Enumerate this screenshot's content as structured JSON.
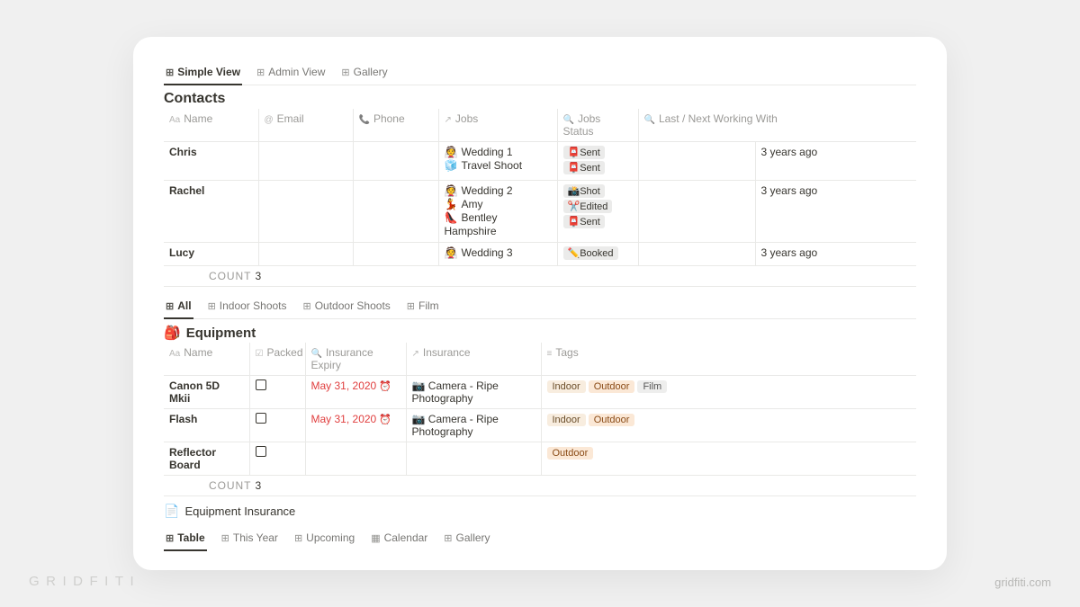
{
  "watermark": {
    "brand": "GRIDFITI",
    "url": "gridfiti.com"
  },
  "contacts": {
    "tabs": [
      {
        "label": "Simple View",
        "icon": "⊞",
        "active": true
      },
      {
        "label": "Admin View",
        "icon": "⊞",
        "active": false
      },
      {
        "label": "Gallery",
        "icon": "⊞",
        "active": false
      }
    ],
    "title": "Contacts",
    "columns": {
      "name": {
        "label": "Name",
        "icon": "Aa"
      },
      "email": {
        "label": "Email",
        "icon": "@"
      },
      "phone": {
        "label": "Phone",
        "icon": "📞"
      },
      "jobs": {
        "label": "Jobs",
        "icon": "↗"
      },
      "status": {
        "label": "Jobs Status",
        "icon": "🔍"
      },
      "last": {
        "label": "Last / Next Working With",
        "icon": "🔍"
      }
    },
    "rows": [
      {
        "name": "Chris",
        "jobs": [
          {
            "emoji": "👰",
            "text": "Wedding 1"
          },
          {
            "emoji": "🧊",
            "text": "Travel Shoot"
          }
        ],
        "status": [
          {
            "emoji": "📮",
            "text": "Sent"
          },
          {
            "emoji": "📮",
            "text": "Sent"
          }
        ],
        "last": "3 years ago"
      },
      {
        "name": "Rachel",
        "jobs": [
          {
            "emoji": "👰",
            "text": "Wedding 2"
          },
          {
            "emoji": "💃",
            "text": "Amy"
          },
          {
            "emoji": "👠",
            "text": "Bentley"
          },
          {
            "emoji": "",
            "text": "Hampshire"
          }
        ],
        "status": [
          {
            "emoji": "📸",
            "text": "Shot"
          },
          {
            "emoji": "✂️",
            "text": "Edited"
          },
          {
            "emoji": "📮",
            "text": "Sent"
          }
        ],
        "last": "3 years ago"
      },
      {
        "name": "Lucy",
        "jobs": [
          {
            "emoji": "👰",
            "text": "Wedding 3"
          }
        ],
        "status": [
          {
            "emoji": "✏️",
            "text": "Booked"
          }
        ],
        "last": "3 years ago"
      }
    ],
    "count_label": "COUNT",
    "count": "3"
  },
  "equipment": {
    "tabs": [
      {
        "label": "All",
        "icon": "⊞",
        "active": true
      },
      {
        "label": "Indoor Shoots",
        "icon": "⊞",
        "active": false
      },
      {
        "label": "Outdoor Shoots",
        "icon": "⊞",
        "active": false
      },
      {
        "label": "Film",
        "icon": "⊞",
        "active": false
      }
    ],
    "title_emoji": "🎒",
    "title": "Equipment",
    "columns": {
      "name": {
        "label": "Name",
        "icon": "Aa"
      },
      "packed": {
        "label": "Packed",
        "icon": "☑"
      },
      "expiry": {
        "label": "Insurance Expiry",
        "icon": "🔍"
      },
      "insurance": {
        "label": "Insurance",
        "icon": "↗"
      },
      "tags": {
        "label": "Tags",
        "icon": "≡"
      }
    },
    "rows": [
      {
        "name": "Canon 5D Mkii",
        "packed": false,
        "expiry": "May 31, 2020",
        "insurance": {
          "emoji": "📷",
          "text": "Camera - Ripe Photography"
        },
        "tags": [
          "Indoor",
          "Outdoor",
          "Film"
        ]
      },
      {
        "name": "Flash",
        "packed": false,
        "expiry": "May 31, 2020",
        "insurance": {
          "emoji": "📷",
          "text": "Camera - Ripe Photography"
        },
        "tags": [
          "Indoor",
          "Outdoor"
        ]
      },
      {
        "name": "Reflector Board",
        "packed": false,
        "expiry": "",
        "insurance": null,
        "tags": [
          "Outdoor"
        ]
      }
    ],
    "count_label": "COUNT",
    "count": "3",
    "linked_page": {
      "emoji": "📄",
      "text": "Equipment Insurance"
    }
  },
  "bottom_tabs": [
    {
      "label": "Table",
      "icon": "⊞",
      "active": true
    },
    {
      "label": "This Year",
      "icon": "⊞",
      "active": false
    },
    {
      "label": "Upcoming",
      "icon": "⊞",
      "active": false
    },
    {
      "label": "Calendar",
      "icon": "▦",
      "active": false
    },
    {
      "label": "Gallery",
      "icon": "⊞",
      "active": false
    }
  ]
}
